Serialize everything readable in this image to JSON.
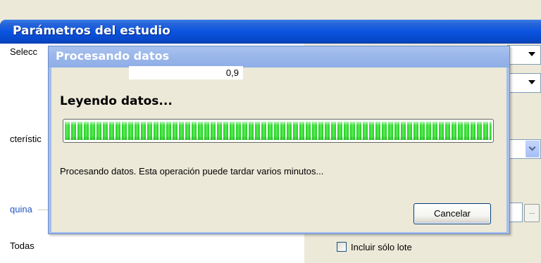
{
  "background_window": {
    "title": "Parámetros del estudio",
    "labels": {
      "selection": "Selecc",
      "characteristic": "cterístic",
      "machine": "quina",
      "all": "Todas"
    },
    "checkbox_label": "Incluir sólo lote",
    "ellipsis_button": "..."
  },
  "dialog": {
    "title": "Procesando datos",
    "value": "0,9",
    "status": "Leyendo datos...",
    "progress": 1.0,
    "message": "Procesando datos. Esta operación puede tardar varios minutos...",
    "cancel_label": "Cancelar"
  },
  "colors": {
    "progress_green": "#2fd62f",
    "title_blue": "#0a54e0",
    "inactive_title_blue": "#9cb8eb"
  }
}
